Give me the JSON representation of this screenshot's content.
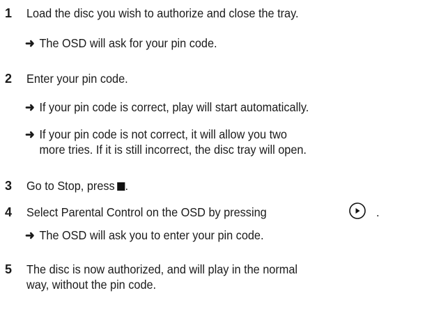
{
  "steps": [
    {
      "number": "1",
      "text": "Load the disc you wish to authorize and close the tray.",
      "results": [
        "The OSD will ask for your pin code."
      ]
    },
    {
      "number": "2",
      "text": "Enter your pin code.",
      "results": [
        "If your pin code is correct, play will start automatically.",
        "If your pin code is not correct, it will allow you two",
        "more tries. If it is still incorrect, the disc tray will open."
      ]
    },
    {
      "number": "3",
      "text": "Go to Stop, press",
      "icon": "stop-square-icon"
    },
    {
      "number": "4",
      "text": "Select Parental Control on the OSD by pressing",
      "text_after": ".",
      "icon": "play-circle-icon",
      "results": [
        "The OSD will ask you to enter your pin code."
      ]
    },
    {
      "number": "5",
      "text": "The disc is now authorized, and will play in the normal",
      "text_line2": "way, without the pin code."
    }
  ],
  "arrow_glyph": "➜"
}
